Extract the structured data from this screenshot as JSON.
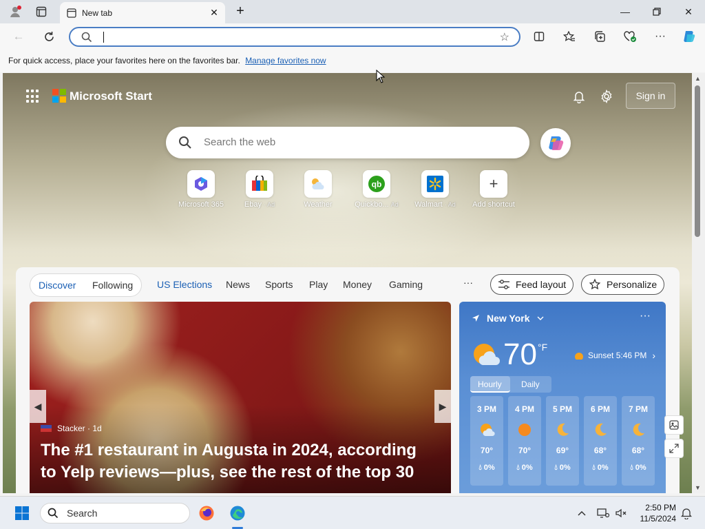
{
  "browser": {
    "tab_title": "New tab",
    "address_value": "",
    "favorites_bar_text": "For quick access, place your favorites here on the favorites bar.",
    "favorites_bar_link": "Manage favorites now"
  },
  "header": {
    "brand": "Microsoft Start",
    "sign_in": "Sign in"
  },
  "search": {
    "placeholder": "Search the web"
  },
  "shortcuts": [
    {
      "label": "Microsoft 365",
      "ad": ""
    },
    {
      "label": "Ebay",
      "ad": "· Ad"
    },
    {
      "label": "Weather",
      "ad": ""
    },
    {
      "label": "Quickbo...",
      "ad": "Ad"
    },
    {
      "label": "Walmart",
      "ad": "· Ad"
    },
    {
      "label": "Add shortcut",
      "ad": ""
    }
  ],
  "feed": {
    "pill_tabs": [
      "Discover",
      "Following"
    ],
    "tabs": [
      "US Elections",
      "News",
      "Sports",
      "Play",
      "Money",
      "Gaming"
    ],
    "more": "···",
    "feed_layout": "Feed layout",
    "personalize": "Personalize"
  },
  "hero": {
    "source": "Stacker",
    "age": "· 1d",
    "title": "The #1 restaurant in Augusta in 2024, according to Yelp reviews—plus, see the rest of the top 30"
  },
  "weather": {
    "location": "New York",
    "temp": "70",
    "unit": "°F",
    "sunset": "Sunset 5:46 PM",
    "tabs": [
      "Hourly",
      "Daily"
    ],
    "hours": [
      {
        "time": "3 PM",
        "temp": "70°",
        "precip": "0%",
        "icon": "partly-sunny-icon"
      },
      {
        "time": "4 PM",
        "temp": "70°",
        "precip": "0%",
        "icon": "sun-icon"
      },
      {
        "time": "5 PM",
        "temp": "69°",
        "precip": "0%",
        "icon": "moon-icon"
      },
      {
        "time": "6 PM",
        "temp": "68°",
        "precip": "0%",
        "icon": "moon-icon"
      },
      {
        "time": "7 PM",
        "temp": "68°",
        "precip": "0%",
        "icon": "moon-icon"
      }
    ]
  },
  "taskbar": {
    "search": "Search",
    "time": "2:50 PM",
    "date": "11/5/2024"
  },
  "colors": {
    "accent": "#1a5fb4",
    "address_border": "#4a7dc4",
    "weather_bg": "#4a82cc"
  }
}
